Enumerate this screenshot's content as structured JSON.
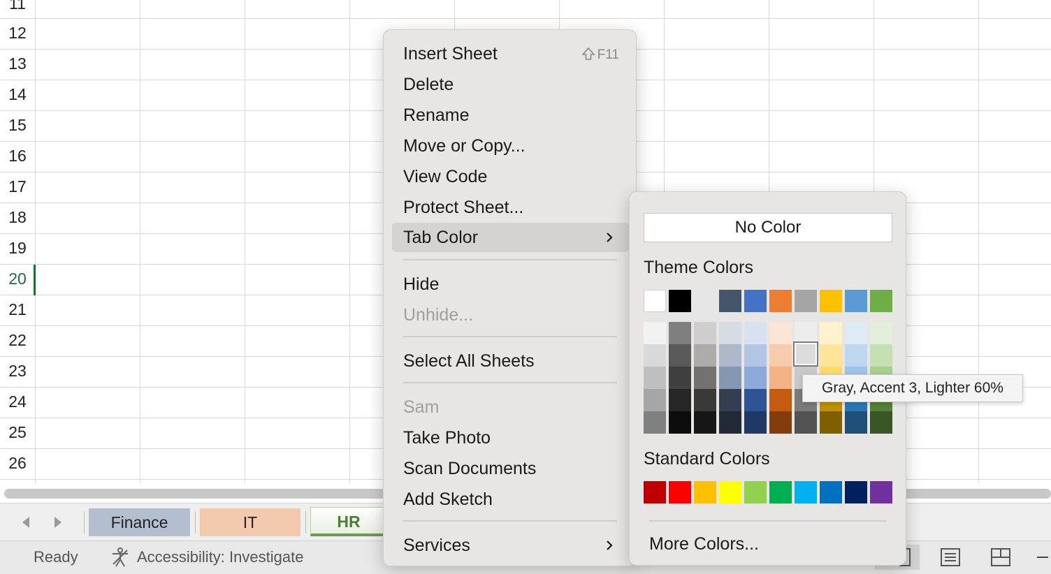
{
  "grid": {
    "row_numbers": [
      "11",
      "12",
      "13",
      "14",
      "15",
      "16",
      "17",
      "18",
      "19",
      "20",
      "21",
      "22",
      "23",
      "24",
      "25",
      "26"
    ],
    "active_row": "20"
  },
  "sheet_tabs": [
    {
      "label": "Finance",
      "color": "#b3bfcf"
    },
    {
      "label": "IT",
      "color": "#f3c9ae"
    },
    {
      "label": "HR",
      "color": "#6d9a4e",
      "selected": true
    }
  ],
  "status_bar": {
    "ready": "Ready",
    "accessibility": "Accessibility: Investigate"
  },
  "context_menu": {
    "insert_sheet": "Insert Sheet",
    "insert_sheet_shortcut": "F11",
    "delete": "Delete",
    "rename": "Rename",
    "move_or_copy": "Move or Copy...",
    "view_code": "View Code",
    "protect_sheet": "Protect Sheet...",
    "tab_color": "Tab Color",
    "hide": "Hide",
    "unhide": "Unhide...",
    "select_all_sheets": "Select All Sheets",
    "sam": "Sam",
    "take_photo": "Take Photo",
    "scan_documents": "Scan Documents",
    "add_sketch": "Add Sketch",
    "services": "Services"
  },
  "tab_color_submenu": {
    "no_color": "No Color",
    "theme_colors_heading": "Theme Colors",
    "standard_colors_heading": "Standard Colors",
    "more_colors": "More Colors...",
    "theme_colors": [
      "#ffffff",
      "#000000",
      "#e7e6e6",
      "#44546a",
      "#4472c4",
      "#ed7d31",
      "#a5a5a5",
      "#ffc000",
      "#5b9bd5",
      "#70ad47"
    ],
    "theme_shades": [
      [
        "#f2f2f2",
        "#d9d9d9",
        "#bfbfbf",
        "#a6a6a6",
        "#808080"
      ],
      [
        "#7f7f7f",
        "#595959",
        "#404040",
        "#262626",
        "#0d0d0d"
      ],
      [
        "#d0cece",
        "#aeabab",
        "#757171",
        "#3b3838",
        "#171616"
      ],
      [
        "#d6dce4",
        "#adb9ca",
        "#8496b0",
        "#333f50",
        "#222a35"
      ],
      [
        "#d9e2f3",
        "#b4c6e7",
        "#8eaadb",
        "#2f5496",
        "#1f3864"
      ],
      [
        "#fbe5d5",
        "#f7cbac",
        "#f4b183",
        "#c55a11",
        "#833c0b"
      ],
      [
        "#ededed",
        "#dbdbdb",
        "#c9c9c9",
        "#7b7b7b",
        "#525252"
      ],
      [
        "#fff2cc",
        "#ffe599",
        "#ffd966",
        "#bf9000",
        "#7f6000"
      ],
      [
        "#deebf6",
        "#bdd7ee",
        "#9dc3e6",
        "#2e75b5",
        "#1f4e79"
      ],
      [
        "#e2efd9",
        "#c5e0b3",
        "#a8d08d",
        "#538135",
        "#375623"
      ]
    ],
    "standard_colors": [
      "#c00000",
      "#ff0000",
      "#ffc000",
      "#ffff00",
      "#92d050",
      "#00b050",
      "#00b0f0",
      "#0070c0",
      "#002060",
      "#7030a0"
    ],
    "selected_swatch": "Gray, Accent 3, Lighter 60%"
  },
  "tooltip": "Gray, Accent 3, Lighter 60%"
}
